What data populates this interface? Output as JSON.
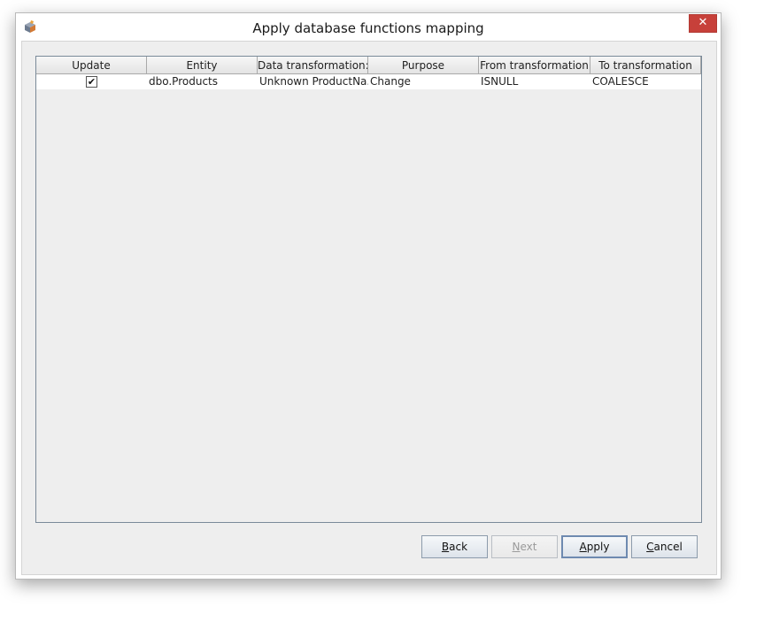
{
  "window": {
    "title": "Apply database functions mapping",
    "close_glyph": "✕"
  },
  "table": {
    "columns": [
      "Update",
      "Entity",
      "Data transformation:",
      "Purpose",
      "From transformation",
      "To transformation"
    ],
    "rows": [
      {
        "update_checked": true,
        "check_glyph": "✔",
        "entity": "dbo.Products",
        "data_transformation": "Unknown ProductNa...",
        "purpose": "Change",
        "from_transformation": "ISNULL",
        "to_transformation": "COALESCE"
      }
    ]
  },
  "buttons": {
    "back": {
      "mnemonic": "B",
      "rest": "ack"
    },
    "next": {
      "mnemonic": "N",
      "rest": "ext",
      "enabled": false
    },
    "apply": {
      "mnemonic": "A",
      "rest": "pply"
    },
    "cancel": {
      "mnemonic": "C",
      "rest": "ancel"
    }
  },
  "colors": {
    "close_button": "#c7403a",
    "dialog_background": "#eeeeee"
  },
  "icons": {
    "app": "app-logo-icon",
    "close": "close-icon",
    "checkbox": "checkbox-checked-icon"
  }
}
